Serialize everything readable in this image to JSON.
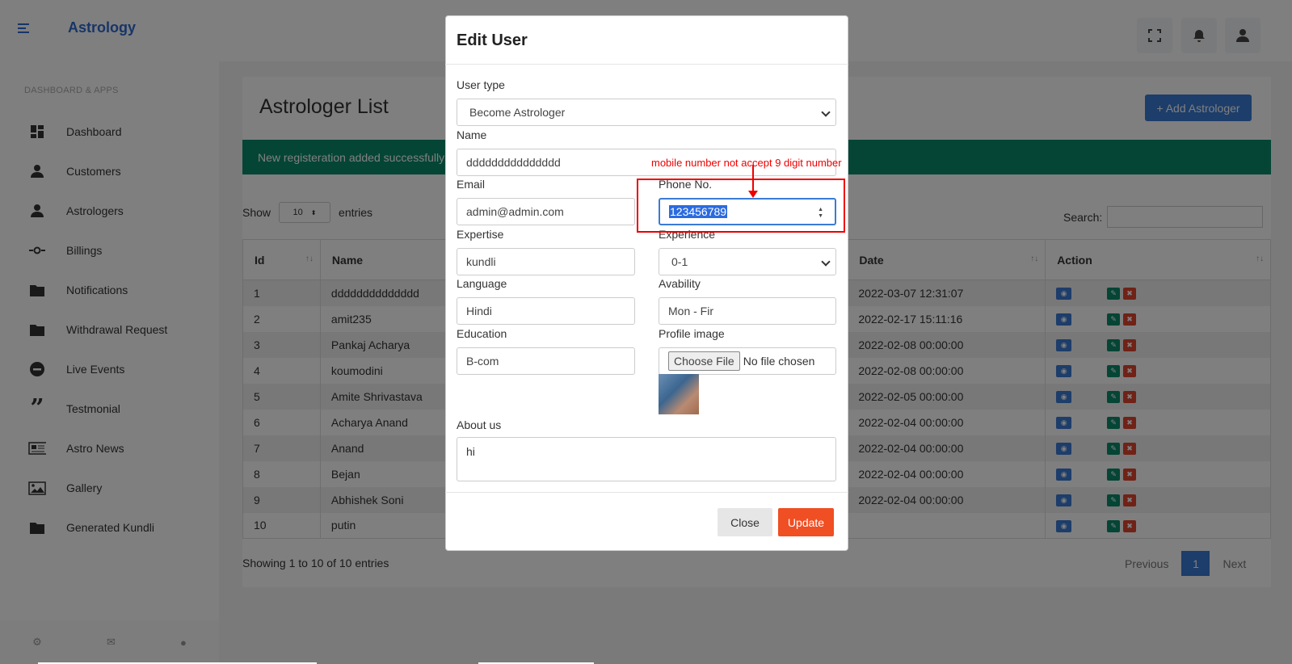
{
  "app": {
    "brand": "Astrology"
  },
  "sidebar": {
    "heading": "DASHBOARD & APPS",
    "items": [
      {
        "label": "Dashboard",
        "icon": "dashboard-icon"
      },
      {
        "label": "Customers",
        "icon": "user-icon"
      },
      {
        "label": "Astrologers",
        "icon": "user-icon"
      },
      {
        "label": "Billings",
        "icon": "billing-icon"
      },
      {
        "label": "Notifications",
        "icon": "folder-icon"
      },
      {
        "label": "Withdrawal Request",
        "icon": "folder-icon"
      },
      {
        "label": "Live Events",
        "icon": "minus-circle-icon"
      },
      {
        "label": "Testmonial",
        "icon": "quote-icon"
      },
      {
        "label": "Astro News",
        "icon": "newspaper-icon"
      },
      {
        "label": "Gallery",
        "icon": "image-icon"
      },
      {
        "label": "Generated Kundli",
        "icon": "folder-icon"
      }
    ],
    "footer_icons": [
      "gear-icon",
      "mail-icon",
      "lock-icon"
    ]
  },
  "page": {
    "title": "Astrologer List",
    "add_button": "+ Add Astrologer",
    "alert": "New registeration added successfully",
    "show_label": "Show",
    "entries_label": "entries",
    "page_length": "10",
    "search_label": "Search:",
    "info": "Showing 1 to 10 of 10 entries",
    "pager": {
      "previous": "Previous",
      "current": "1",
      "next": "Next"
    }
  },
  "table": {
    "headers": {
      "id": "Id",
      "name": "Name",
      "date": "Date",
      "action": "Action"
    },
    "rows": [
      {
        "id": "1",
        "name": "dddddddddddddd",
        "date": "2022-03-07 12:31:07"
      },
      {
        "id": "2",
        "name": "amit235",
        "date": "2022-02-17 15:11:16"
      },
      {
        "id": "3",
        "name": "Pankaj Acharya",
        "date": "2022-02-08 00:00:00"
      },
      {
        "id": "4",
        "name": "koumodini",
        "date": "2022-02-08 00:00:00"
      },
      {
        "id": "5",
        "name": "Amite Shrivastava",
        "date": "2022-02-05 00:00:00"
      },
      {
        "id": "6",
        "name": "Acharya Anand",
        "date": "2022-02-04 00:00:00"
      },
      {
        "id": "7",
        "name": "Anand",
        "date": "2022-02-04 00:00:00"
      },
      {
        "id": "8",
        "name": "Bejan",
        "date": "2022-02-04 00:00:00"
      },
      {
        "id": "9",
        "name": "Abhishek Soni",
        "date": "2022-02-04 00:00:00"
      },
      {
        "id": "10",
        "name": "putin",
        "date": ""
      }
    ]
  },
  "modal": {
    "title": "Edit User",
    "user_type": {
      "label": "User type",
      "value": "Become Astrologer"
    },
    "name": {
      "label": "Name",
      "value": "ddddddddddddddd"
    },
    "email": {
      "label": "Email",
      "value": "admin@admin.com"
    },
    "phone": {
      "label": "Phone No.",
      "value": "123456789"
    },
    "expertise": {
      "label": "Expertise",
      "value": "kundli"
    },
    "experience": {
      "label": "Experience",
      "value": "0-1"
    },
    "language": {
      "label": "Language",
      "value": "Hindi"
    },
    "availability": {
      "label": "Avability",
      "value": "Mon - Fir"
    },
    "education": {
      "label": "Education",
      "value": "B-com"
    },
    "profile_image": {
      "label": "Profile image",
      "button": "Choose File",
      "status": "No file chosen"
    },
    "about": {
      "label": "About us",
      "value": "hi"
    },
    "close": "Close",
    "update": "Update"
  },
  "annotation": {
    "text": "mobile number not accept 9 digit number",
    "color": "#e00000"
  },
  "colors": {
    "primary": "#3a7bd5",
    "success": "#0b8a6b",
    "danger": "#e0452f",
    "update": "#f04e23"
  }
}
